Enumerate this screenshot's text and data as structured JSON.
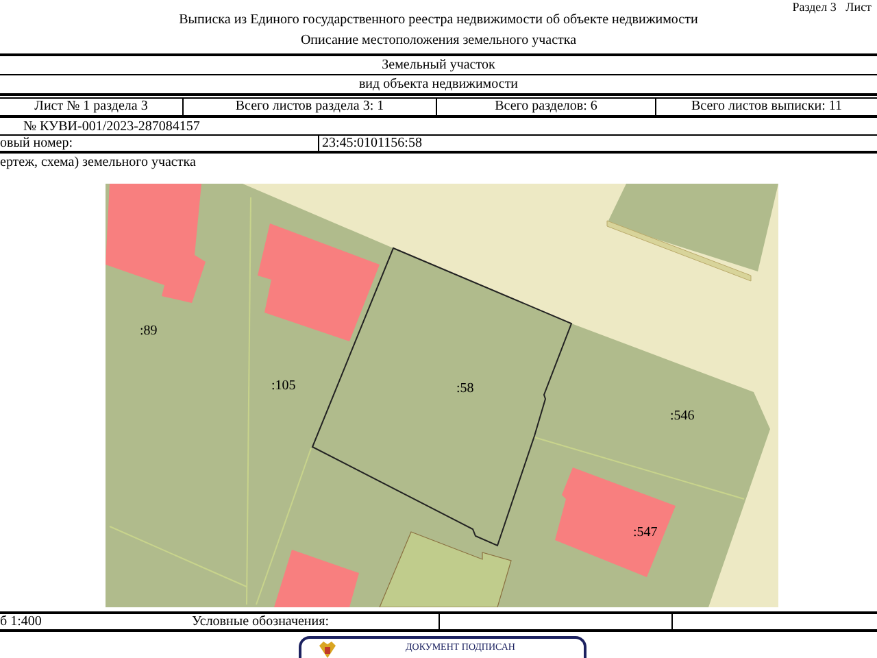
{
  "header": {
    "section_sheet": "Раздел 3   Лист",
    "title": "Выписка из Единого государственного реестра недвижимости об объекте недвижимости",
    "subtitle": "Описание местоположения земельного участка"
  },
  "object": {
    "name": "Земельный участок",
    "caption": "вид объекта недвижимости"
  },
  "sheets": [
    "Лист № 1 раздела 3",
    "Всего листов раздела 3: 1",
    "Всего разделов: 6",
    "Всего листов выписки: 11"
  ],
  "doc_number": "№ КУВИ-001/2023-287084157",
  "cadastral": {
    "label": "овый номер:",
    "value": "23:45:0101156:58"
  },
  "plan_caption": "ертеж, схема) земельного участка",
  "map": {
    "labels": [
      {
        "text": ":89",
        "kind": "plot"
      },
      {
        "text": ":105",
        "kind": "plot"
      },
      {
        "text": ":58",
        "kind": "plot"
      },
      {
        "text": ":546",
        "kind": "plot"
      },
      {
        "text": ":547",
        "kind": "plot"
      }
    ]
  },
  "footer": {
    "scale": "б 1:400",
    "legend": "Условные обозначения:"
  },
  "stamp": {
    "text": "ДОКУМЕНТ ПОДПИСАН"
  }
}
